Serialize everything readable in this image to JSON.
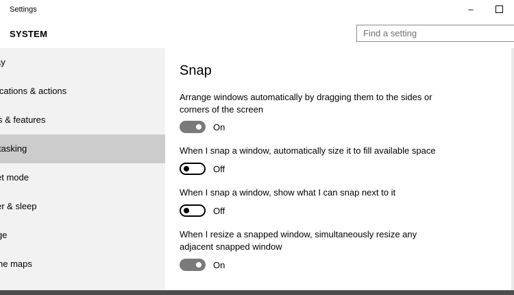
{
  "window": {
    "title": "Settings",
    "minimize_glyph": "–"
  },
  "header": {
    "section": "SYSTEM",
    "search_placeholder": "Find a setting"
  },
  "sidebar": {
    "items": [
      {
        "label": "ay"
      },
      {
        "label": "ications & actions"
      },
      {
        "label": "s & features"
      },
      {
        "label": "tasking"
      },
      {
        "label": "et mode"
      },
      {
        "label": "er & sleep"
      },
      {
        "label": "ge"
      },
      {
        "label": "ne maps"
      }
    ],
    "selected_index": 3
  },
  "content": {
    "title": "Snap",
    "settings": [
      {
        "description": "Arrange windows automatically by dragging them to the sides or corners of the screen",
        "state": "On"
      },
      {
        "description": "When I snap a window, automatically size it to fill available space",
        "state": "Off"
      },
      {
        "description": "When I snap a window, show what I can snap next to it",
        "state": "Off"
      },
      {
        "description": "When I resize a snapped window, simultaneously resize any adjacent snapped window",
        "state": "On"
      }
    ]
  },
  "colors": {
    "sidebar_bg": "#f2f2f2",
    "selected_bg": "#cccccc",
    "toggle_on": "#7a7a7a"
  }
}
